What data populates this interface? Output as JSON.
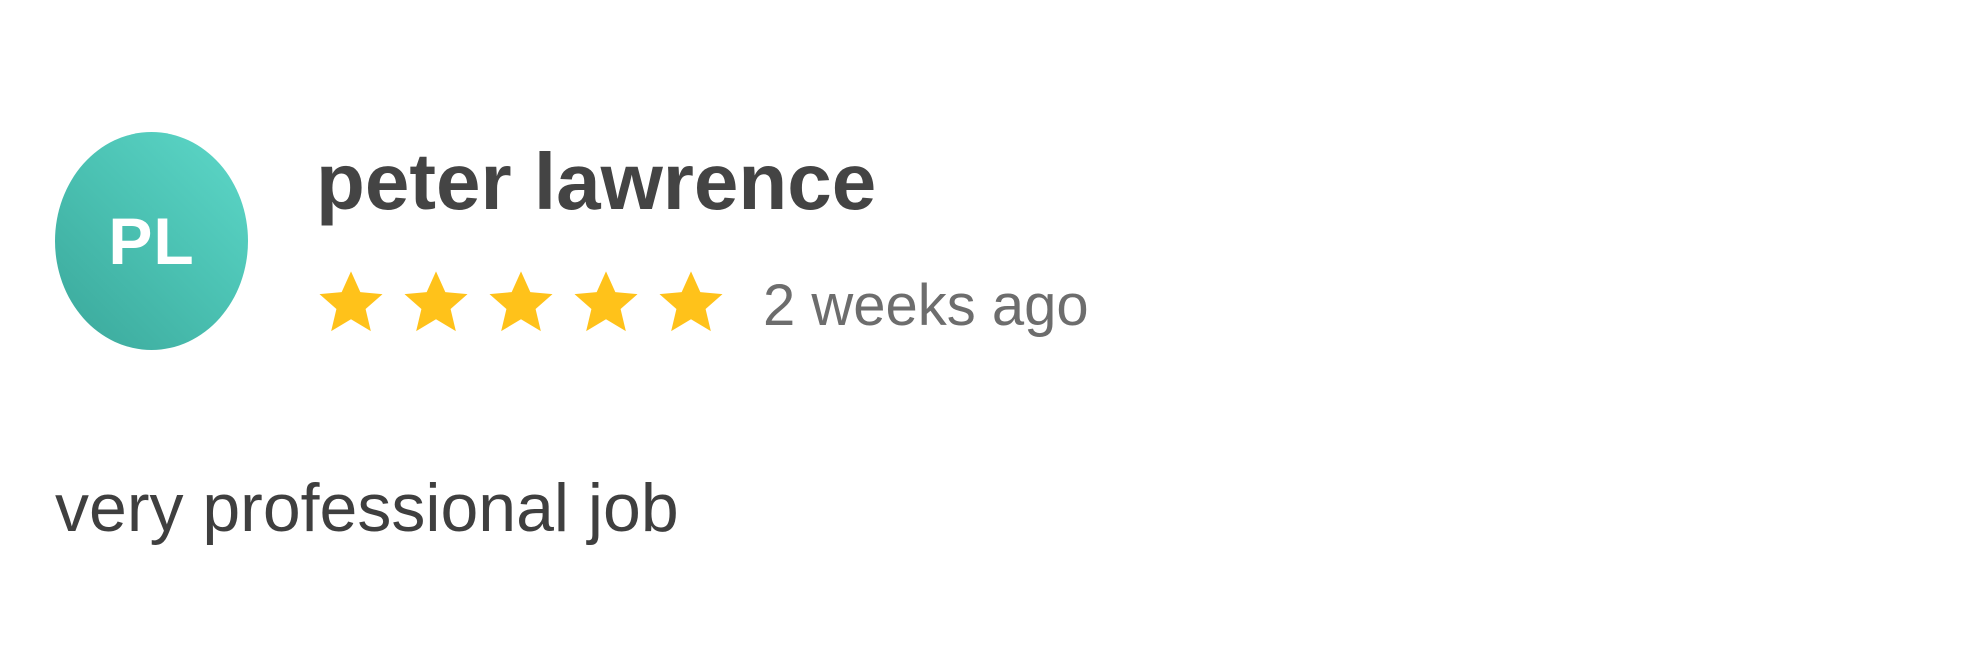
{
  "review": {
    "avatar": {
      "initials": "PL",
      "colors": [
        "#5ed8c9",
        "#3aa79a"
      ]
    },
    "reviewer_name": "peter lawrence",
    "rating": {
      "value": 5,
      "max": 5,
      "star_icon": "star-icon",
      "star_color": "#ffc21a"
    },
    "date": "2 weeks ago",
    "text": "very professional job"
  }
}
